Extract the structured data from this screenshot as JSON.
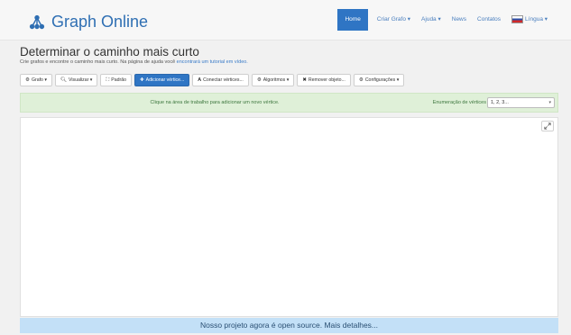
{
  "brand": {
    "name": "Graph Online",
    "icon": "graph-tree-icon"
  },
  "nav": {
    "home": "Home",
    "create_graph": "Criar Grafo ▾",
    "help": "Ajuda ▾",
    "news": "News",
    "contacts": "Contatos",
    "language": "Língua ▾"
  },
  "heading": {
    "title": "Determinar o caminho mais curto",
    "subtitle_text": "Crie grafos e encontre o caminho mais curto. Na página de ajuda você",
    "subtitle_link": "encontrará um tutorial em vídeo."
  },
  "toolbar": {
    "graph": "Grafo ▾",
    "view": "Visualizar ▾",
    "default": "Padrão",
    "add_vertex": "Adicionar vértice...",
    "connect_vertices": "Conectar vértices...",
    "algorithms": "Algoritmos ▾",
    "remove_object": "Remover objeto...",
    "settings": "Configurações ▾"
  },
  "info": {
    "message": "Clique na área de trabalho para adicionar um novo vértice.",
    "enum_label": "Enumeração de vértices",
    "enum_value": "1, 2, 3..."
  },
  "footer": {
    "text": "Nosso projeto agora é open source. Mais detalhes..."
  },
  "colors": {
    "brand": "#2f6fb3",
    "primary": "#2f75c4",
    "info_bg": "#dff0d8",
    "footer_bg": "#c3e0f7"
  }
}
